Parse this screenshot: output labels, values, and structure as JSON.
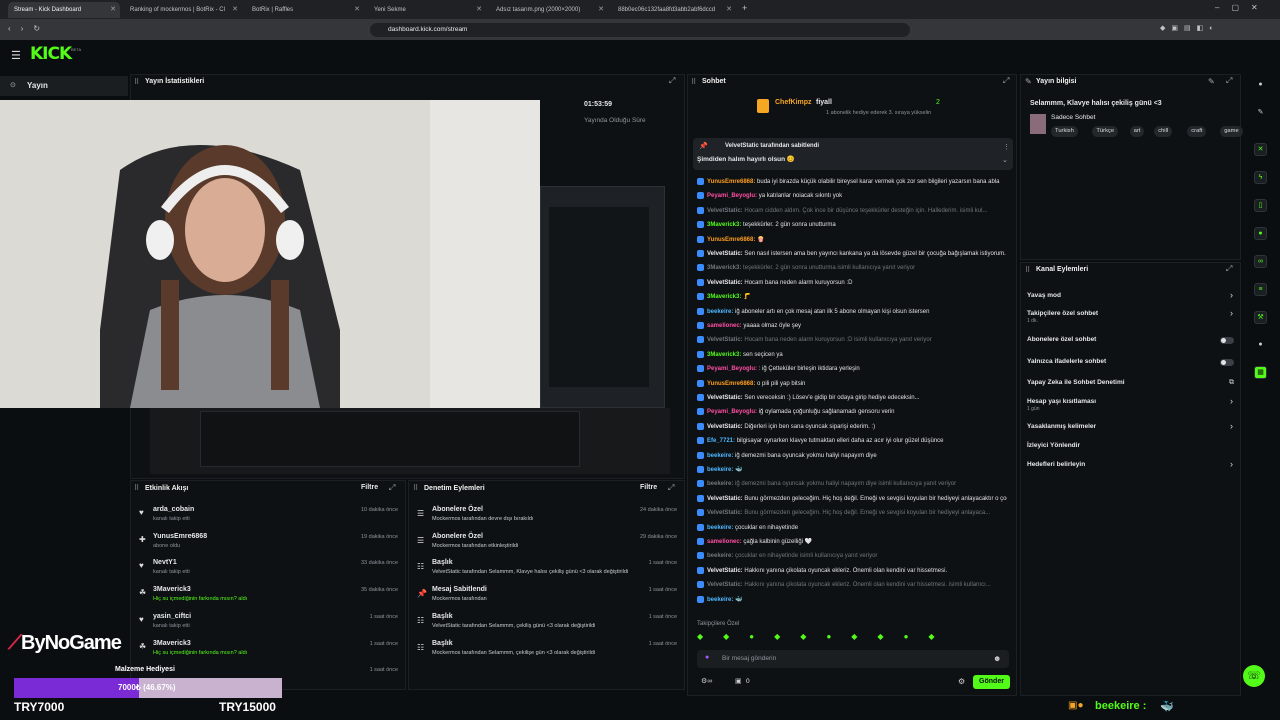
{
  "browser": {
    "tabs": [
      {
        "label": "Stream - Kick Dashboard",
        "active": true
      },
      {
        "label": "Ranking of mockermos | BotRix - Cl",
        "active": false
      },
      {
        "label": "BotRix | Raffles",
        "active": false
      },
      {
        "label": "Yeni Sekme",
        "active": false
      },
      {
        "label": "Adsız tasarım.png (2000×2000)",
        "active": false
      },
      {
        "label": "88b0ec06c132faa8fd3abb2abf6dccd",
        "active": false
      }
    ],
    "url": "dashboard.kick.com/stream",
    "notice": "1 abonelik hediye ederek 3. sıraya yükselin"
  },
  "app": {
    "logo": "KICK",
    "logo_badge": "BETA",
    "nav_item": "Yayın"
  },
  "stream_stats": {
    "title": "Yayın İstatistikleri",
    "duration": "01:53:59",
    "duration_label": "Yayında Olduğu Süre"
  },
  "chat": {
    "title": "Sohbet",
    "top_gifter": {
      "name": "ChefKimpz",
      "count": "2",
      "name2": "fiyall",
      "count2": "2"
    },
    "pinned_by": "VelvetStatic tarafından sabitlendi",
    "pinned_message": "Şimdiden halım hayırlı olsun 😊",
    "messages": [
      {
        "user": "YunusEmre6868:",
        "text": " buda iyi birazda küçük olabilir bireysel karar vermek çok zor sen bilgileri yazarsın bana abla",
        "color": "#ff9f1c"
      },
      {
        "user": "Peyami_Beyoglu:",
        "text": " ya katılanlar noiacak sıkıntı yok",
        "color": "#ff4fa3"
      },
      {
        "user": "VelvetStatic:",
        "text": " Hocam cidden aldım. Çok ince bir düşünce teşekkürler desteğin için. Hallederim. isimli kul...",
        "color": "#6f767c"
      },
      {
        "user": "3Maverick3:",
        "text": " teşekkürler. 2 gün sonra unutturma",
        "color": "#53fc18"
      },
      {
        "user": "YunusEmre6868:",
        "text": " 🍿",
        "color": "#ff9f1c"
      },
      {
        "user": "VelvetStatic:",
        "text": " Sen nasıl istersen ama ben yayıncı kankana ya da lösevde güzel bir çocuğa bağışlamak istiyorum.",
        "color": "#e8e8e8"
      },
      {
        "user": "3Maverick3:",
        "text": " teşekkürler. 2 gün sonra unutturma isimli kullanıcıya yanıt veriyor",
        "color": "#6f767c"
      },
      {
        "user": "VelvetStatic:",
        "text": " Hocam bana neden alarm kuruyorsun :D",
        "color": "#e8e8e8"
      },
      {
        "user": "3Maverick3:",
        "text": " 🦵",
        "color": "#53fc18"
      },
      {
        "user": "beekeire:",
        "text": " iğ aboneler artı en çok mesaj atan ilk 5 abone olmayan kişi olsun istersen",
        "color": "#4db8ff"
      },
      {
        "user": "samelionec:",
        "text": " yaaaa olmaz öyle şey",
        "color": "#ff4fa3"
      },
      {
        "user": "VelvetStatic:",
        "text": " Hocam bana neden alarm kuruyorsun :D isimli kullanıcıya yanıt veriyor",
        "color": "#6f767c"
      },
      {
        "user": "3Maverick3:",
        "text": " sen seçicen ya",
        "color": "#53fc18"
      },
      {
        "user": "Peyami_Beyoglu:",
        "text": " : iğ Çetteküler birleşin iktidara yerleşin",
        "color": "#ff4fa3"
      },
      {
        "user": "YunusEmre6868:",
        "text": " o pili pili yap bitsin",
        "color": "#ff9f1c"
      },
      {
        "user": "VelvetStatic:",
        "text": " Sen vereceksin :) Lösev'e gidip bir odaya girip hediye edeceksin...",
        "color": "#e8e8e8"
      },
      {
        "user": "Peyami_Beyoglu:",
        "text": " iğ oylamada çoğunluğu sağlanamadı gensoru verin",
        "color": "#ff4fa3"
      },
      {
        "user": "VelvetStatic:",
        "text": " Diğerleri için ben sana oyuncak siparişi ederim. :)",
        "color": "#e8e8e8"
      },
      {
        "user": "Efe_7721:",
        "text": " bilgisayar oynarken klavye tutmaktan elleri daha az acır iyi olur güzel düşünce",
        "color": "#4db8ff"
      },
      {
        "user": "beekeire:",
        "text": " iğ demezmi bana oyuncak yokmu haliyi napayım diye",
        "color": "#4db8ff"
      },
      {
        "user": "beekeire:",
        "text": " 🐳",
        "color": "#4db8ff"
      },
      {
        "user": "beekeire:",
        "text": " iğ demezmi bana oyuncak yokmu haliyi napayım diye isimli kullanıcıya yanıt veriyor",
        "color": "#6f767c"
      },
      {
        "user": "VelvetStatic:",
        "text": " Bunu görmezden geleceğim. Hiç hoş değil. Emeği ve sevgisi koyulan bir hediyeyi anlayacaktır o çocuklar...",
        "color": "#e8e8e8"
      },
      {
        "user": "VelvetStatic:",
        "text": " Bunu görmezden geleceğim. Hiç hoş değil. Emeği ve sevgisi koyulan bir hediyeyi anlayaca...",
        "color": "#6f767c"
      },
      {
        "user": "beekeire:",
        "text": " çocuklar en nihayetinde",
        "color": "#4db8ff"
      },
      {
        "user": "samelionec:",
        "text": " çağla kalbinin güzelliği 🤍",
        "color": "#ff4fa3"
      },
      {
        "user": "beekeire:",
        "text": " çocuklar en nihayetinde isimli kullanıcıya yanıt veriyor",
        "color": "#6f767c"
      },
      {
        "user": "VelvetStatic:",
        "text": " Hakkını yanına çikolata oyuncak ekleriz. Önemli olan kendini var hissetmesi.",
        "color": "#e8e8e8"
      },
      {
        "user": "VelvetStatic:",
        "text": " Hakkını yanına çikolata oyuncak ekleriz. Önemli olan kendini var hissetmesi. isimli kullanıcı...",
        "color": "#6f767c"
      },
      {
        "user": "beekeire:",
        "text": " 🐳",
        "color": "#4db8ff"
      }
    ],
    "followers_only": "Takipçilere Özel",
    "input_placeholder": "Bir mesaj gönderin",
    "send_label": "Gönder",
    "counter": "0"
  },
  "stream_info": {
    "title": "Yayın bilgisi",
    "stream_title": "Selammm, Klavye halısı çekiliş günü <3",
    "category": "Sadece Sohbet",
    "tags": [
      "Turkish",
      "Türkçe",
      "art",
      "chill",
      "craft",
      "game",
      "h"
    ]
  },
  "channel_actions": {
    "title": "Kanal Eylemleri",
    "items": [
      {
        "label": "Yavaş mod",
        "sub": "",
        "control": "chevron"
      },
      {
        "label": "Takipçilere özel sohbet",
        "sub": "1 dk.",
        "control": "chevron"
      },
      {
        "label": "Abonelere özel sohbet",
        "sub": "",
        "control": "toggle"
      },
      {
        "label": "Yalnızca ifadelerle sohbet",
        "sub": "",
        "control": "toggle"
      },
      {
        "label": "Yapay Zeka ile Sohbet Denetimi",
        "sub": "",
        "control": "external"
      },
      {
        "label": "Hesap yaşı kısıtlaması",
        "sub": "1 gün",
        "control": "chevron"
      },
      {
        "label": "Yasaklanmış kelimeler",
        "sub": "",
        "control": "chevron"
      },
      {
        "label": "İzleyici Yönlendir",
        "sub": "",
        "control": "none"
      },
      {
        "label": "Hedefleri belirleyin",
        "sub": "",
        "control": "chevron"
      }
    ]
  },
  "activity": {
    "title": "Etkinlik Akışı",
    "filter": "Filtre",
    "items": [
      {
        "name": "arda_cobain",
        "desc": "kanalı takip etti",
        "time": "10 dakika önce"
      },
      {
        "name": "YunusEmre6868",
        "desc": "abone oldu",
        "time": "19 dakika önce"
      },
      {
        "name": "NevtY1",
        "desc": "kanalı takip etti",
        "time": "33 dakika önce"
      },
      {
        "name": "3Maverick3",
        "desc": "Hiç su içmediğinin farkında mısın? aldı",
        "time": "35 dakika önce"
      },
      {
        "name": "yasin_ciftci",
        "desc": "kanalı takip etti",
        "time": "1 saat önce"
      },
      {
        "name": "3Maverick3",
        "desc": "Hiç su içmediğinin farkında mısın? aldı",
        "time": "1 saat önce"
      },
      {
        "name": "Malzeme Hediyesi",
        "desc": "",
        "time": "1 saat önce"
      }
    ]
  },
  "mod_actions": {
    "title": "Denetim Eylemleri",
    "filter": "Filtre",
    "items": [
      {
        "title": "Abonelere Özel",
        "desc": "Mockermos tarafından devre dışı bırakıldı",
        "time": "24 dakika önce"
      },
      {
        "title": "Abonelere Özel",
        "desc": "Mockermos tarafından etkinleştirildi",
        "time": "29 dakika önce"
      },
      {
        "title": "Başlık",
        "desc": "VelvetStatic tarafından Selammm, Klavye halısı çekiliş günü <3 olarak değiştirildi",
        "time": "1 saat önce"
      },
      {
        "title": "Mesaj Sabitlendi",
        "desc": "Mockermos tarafından",
        "time": "1 saat önce"
      },
      {
        "title": "Başlık",
        "desc": "VelvetStatic tarafından Selammm, çekiliş günü <3 olarak değiştirildi",
        "time": "1 saat önce"
      },
      {
        "title": "Başlık",
        "desc": "Mockermos tarafından Selammm, çekilişe gün <3 olarak değiştirildi",
        "time": "1 saat önce"
      }
    ]
  },
  "overlay": {
    "brand": "ByNoGame",
    "goal_current": "TRY7000",
    "goal_target": "TRY15000",
    "progress_text": "7000₺ (46.67%)",
    "progress": 0.4667,
    "ticker_label": "Malzeme Hediyesi",
    "ticker_user": "beekeire :"
  }
}
